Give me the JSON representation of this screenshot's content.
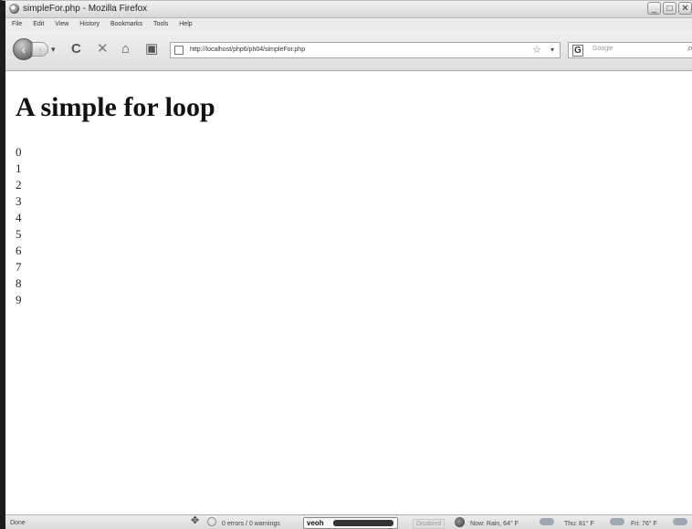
{
  "window": {
    "title": "simpleFor.php - Mozilla Firefox",
    "buttons": [
      "_",
      "□",
      "✕"
    ]
  },
  "menu": {
    "items": [
      {
        "label": "File"
      },
      {
        "label": "Edit"
      },
      {
        "label": "View"
      },
      {
        "label": "History"
      },
      {
        "label": "Bookmarks"
      },
      {
        "label": "Tools"
      },
      {
        "label": "Help"
      }
    ]
  },
  "navigation": {
    "back": "‹",
    "forward": "›",
    "dropdown": "▾",
    "reload": "C",
    "stop": "✕",
    "home": "⌂",
    "bookmark": "▣",
    "url": "http://localhost/php6/ph04/simpleFor.php",
    "star": "☆",
    "url_dropdown": "▾",
    "search_engine": "G",
    "search_placeholder": "Google",
    "search_icon": "⌕"
  },
  "page": {
    "heading": "A simple for loop",
    "numbers": [
      "0",
      "1",
      "2",
      "3",
      "4",
      "5",
      "6",
      "7",
      "8",
      "9"
    ]
  },
  "status": {
    "done": "Done",
    "errors": "0 errors / 0 warnings",
    "veoh": "veoh",
    "disabled": "Disabled",
    "weather_now": "Now: Rain, 64° F",
    "weather_thu": "Thu: 81° F",
    "weather_fri": "Fri: 76° F"
  }
}
